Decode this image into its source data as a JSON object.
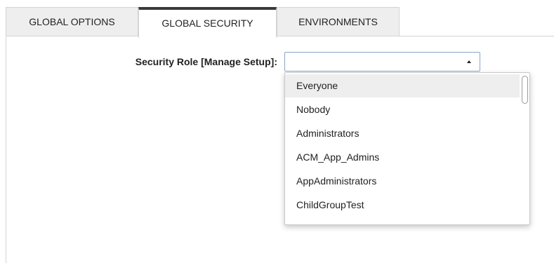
{
  "tabs": [
    {
      "label": "GLOBAL OPTIONS",
      "active": false
    },
    {
      "label": "GLOBAL SECURITY",
      "active": true
    },
    {
      "label": "ENVIRONMENTS",
      "active": false
    }
  ],
  "form": {
    "security_role_label": "Security Role [Manage Setup]:",
    "security_role_value": "",
    "dropdown_open": true
  },
  "dropdown": {
    "options": [
      "Everyone",
      "Nobody",
      "Administrators",
      "ACM_App_Admins",
      "AppAdministrators",
      "ChildGroupTest"
    ],
    "highlighted_option": "Everyone"
  },
  "icons": {
    "select_caret": "caret-up-icon"
  },
  "colors": {
    "active_tab_border": "#3a3a3a",
    "inactive_tab_bg": "#eeeeee",
    "select_border": "#8aa5c8",
    "highlight_bg": "#eeeeee"
  }
}
